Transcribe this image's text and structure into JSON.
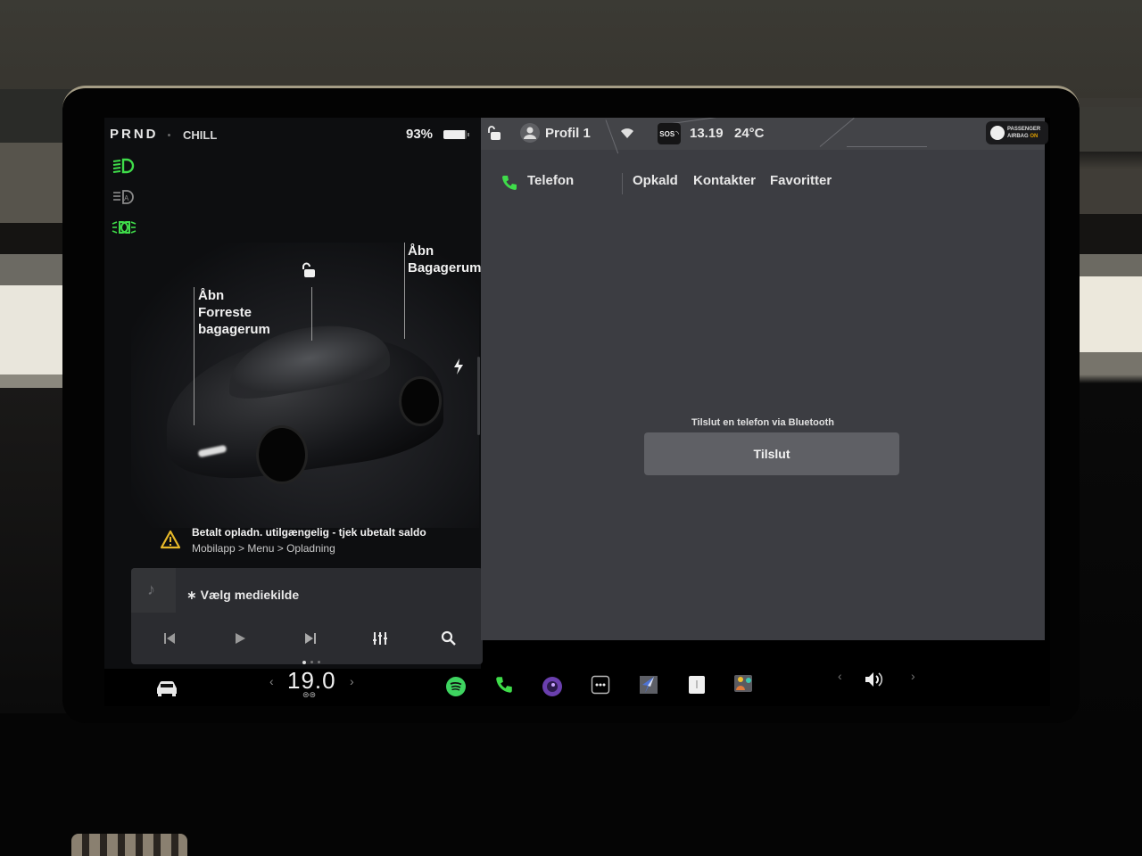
{
  "status": {
    "gear": "PRND",
    "drive_mode": "CHILL",
    "battery_percent": "93%",
    "battery_level": 0.93
  },
  "light_indicators": [
    {
      "icon": "low-beam-headlight-icon",
      "active": true,
      "color": "#3fdc4a"
    },
    {
      "icon": "auto-headlight-icon",
      "active": false,
      "color": "#8a8a8a"
    },
    {
      "icon": "parking-lights-icon",
      "active": true,
      "color": "#3fdc4a"
    }
  ],
  "car_view": {
    "frunk_label_1": "Åbn",
    "frunk_label_2": "Forreste",
    "frunk_label_3": "bagagerum",
    "trunk_label_1": "Åbn",
    "trunk_label_2": "Bagagerum",
    "lock_icon": "unlock-icon",
    "charge_port_icon": "bolt-icon"
  },
  "alert": {
    "title": "Betalt opladn. utilgængelig - tjek ubetalt saldo",
    "subtitle": "Mobilapp > Menu > Opladning",
    "icon": "warning-icon",
    "color": "#e6b829"
  },
  "media": {
    "source_label": "Vælg mediekilde",
    "bluetooth_glyph": "∗",
    "controls": [
      "previous",
      "play",
      "next",
      "equalizer",
      "search"
    ],
    "page_count": 3,
    "active_page": 0
  },
  "top_bar": {
    "profile": "Profil 1",
    "sos": "SOS",
    "time": "13.19",
    "outside_temp": "24°C",
    "airbag_line1": "PASSENGER",
    "airbag_line2": "AIRBAG",
    "airbag_state": "ON"
  },
  "phone": {
    "title": "Telefon",
    "tabs": [
      "Opkald",
      "Kontakter",
      "Favoritter"
    ],
    "prompt": "Tilslut en telefon via Bluetooth",
    "connect_button": "Tilslut",
    "accent": "#3fdc4a"
  },
  "dock": {
    "cabin_temp": "19.0",
    "apps": [
      {
        "name": "spotify",
        "color": "#3ed460"
      },
      {
        "name": "phone",
        "color": "#3fdc4a",
        "active": true
      },
      {
        "name": "camera",
        "color": "#8a4fd0"
      },
      {
        "name": "more",
        "color": "#ffffff"
      },
      {
        "name": "navigation",
        "color": "#4d73d6"
      },
      {
        "name": "manual",
        "color": "#f0f0f0"
      },
      {
        "name": "toybox",
        "color": "#e69e3c"
      }
    ],
    "volume_icon": "speaker-volume-icon"
  }
}
